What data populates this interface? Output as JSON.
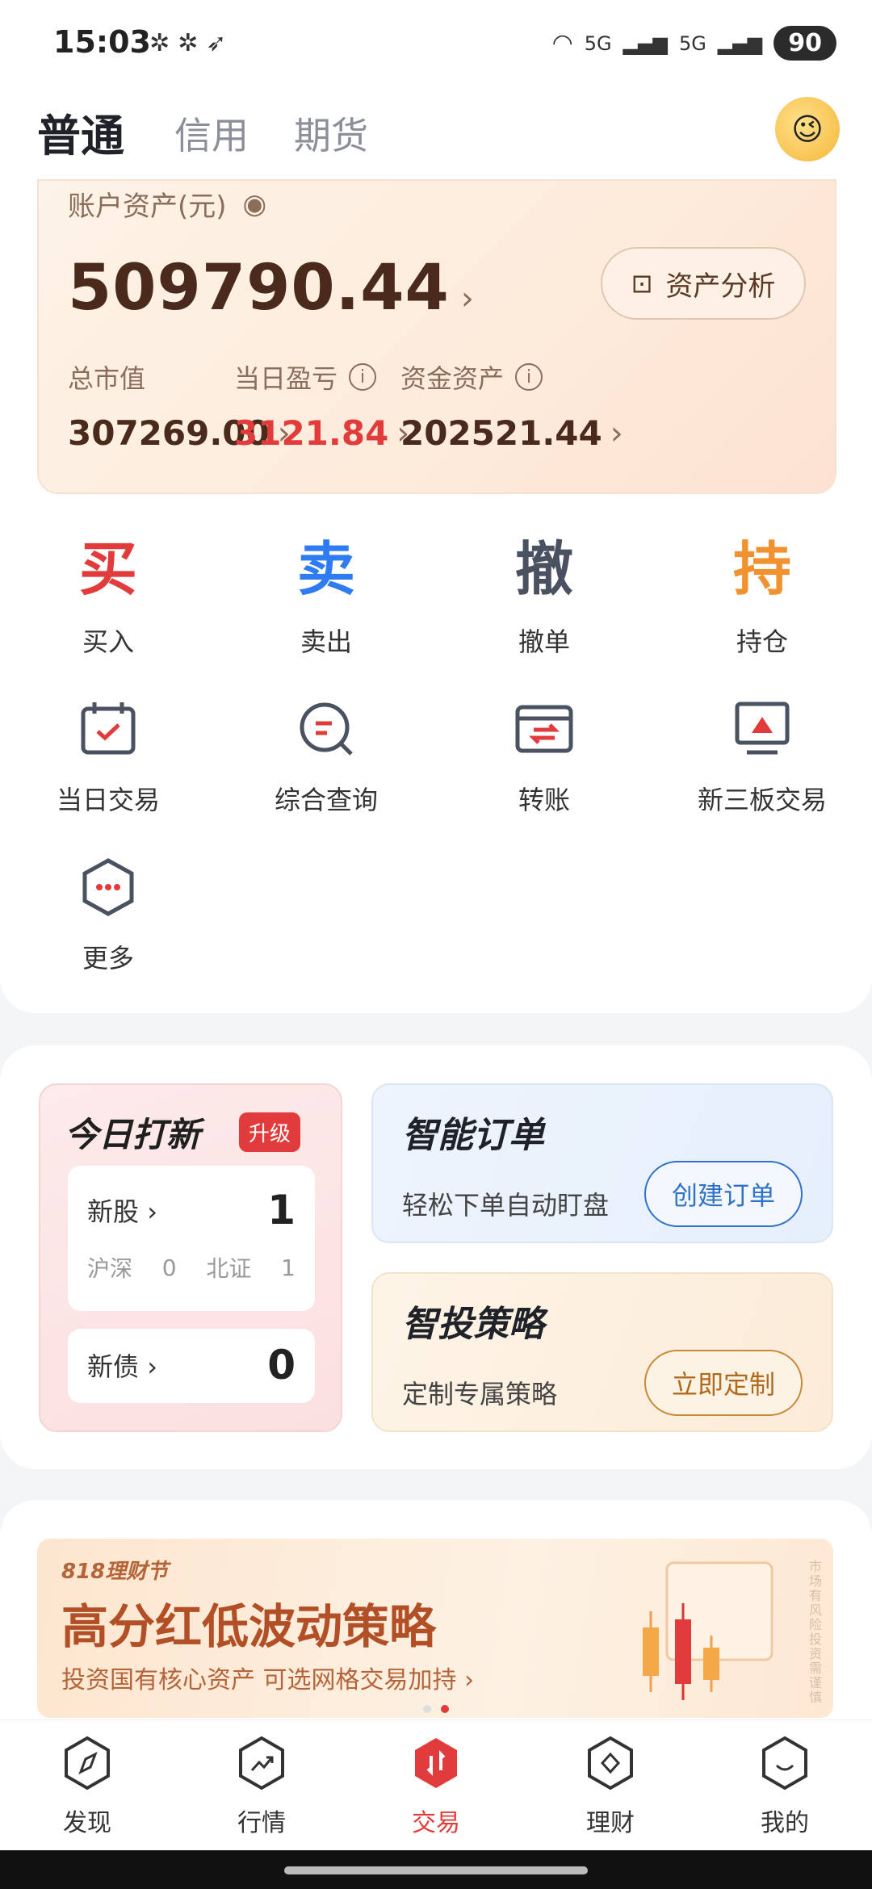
{
  "status_bar": {
    "time": "15:03",
    "icons": [
      "wechat-icon",
      "wechat-icon",
      "location-icon"
    ],
    "net1": "5G",
    "net2": "5G",
    "battery": "90"
  },
  "tabs": [
    {
      "label": "普通"
    },
    {
      "label": "信用"
    },
    {
      "label": "期货"
    }
  ],
  "account": {
    "label": "账户资产(元)",
    "total": "509790.44",
    "analysis_button": "资产分析",
    "stats": [
      {
        "label": "总市值",
        "value": "307269.00"
      },
      {
        "label": "当日盈亏",
        "value": "3121.84"
      },
      {
        "label": "资金资产",
        "value": "202521.44"
      }
    ]
  },
  "trade_actions": [
    {
      "glyph": "买",
      "label": "买入",
      "color": "#e23b3b"
    },
    {
      "glyph": "卖",
      "label": "卖出",
      "color": "#2f7bf2"
    },
    {
      "glyph": "撤",
      "label": "撤单",
      "color": "#4a5160"
    },
    {
      "glyph": "持",
      "label": "持仓",
      "color": "#f0922f"
    }
  ],
  "quick_items": [
    {
      "label": "当日交易",
      "icon": "calendar-check-icon"
    },
    {
      "label": "综合查询",
      "icon": "search-query-icon"
    },
    {
      "label": "转账",
      "icon": "transfer-icon"
    },
    {
      "label": "新三板交易",
      "icon": "monitor-chart-icon"
    },
    {
      "label": "更多",
      "icon": "more-hexagon-icon"
    }
  ],
  "ipo": {
    "title": "今日打新",
    "badge": "升级",
    "stock_label": "新股",
    "stock_count": "1",
    "sh_sz_label": "沪深",
    "sh_sz_count": "0",
    "bj_label": "北证",
    "bj_count": "1",
    "bond_label": "新债",
    "bond_count": "0"
  },
  "smart_order": {
    "title": "智能订单",
    "subtitle": "轻松下单自动盯盘",
    "button": "创建订单"
  },
  "smart_strategy": {
    "title": "智投策略",
    "subtitle": "定制专属策略",
    "button": "立即定制"
  },
  "banner": {
    "tag": "818理财节",
    "title": "高分红低波动策略",
    "subtitle": "投资国有核心资产 可选网格交易加持 ›",
    "side_text": "市场有风险 投资需谨慎"
  },
  "bottom_nav": [
    {
      "label": "发现"
    },
    {
      "label": "行情"
    },
    {
      "label": "交易"
    },
    {
      "label": "理财"
    },
    {
      "label": "我的"
    }
  ]
}
